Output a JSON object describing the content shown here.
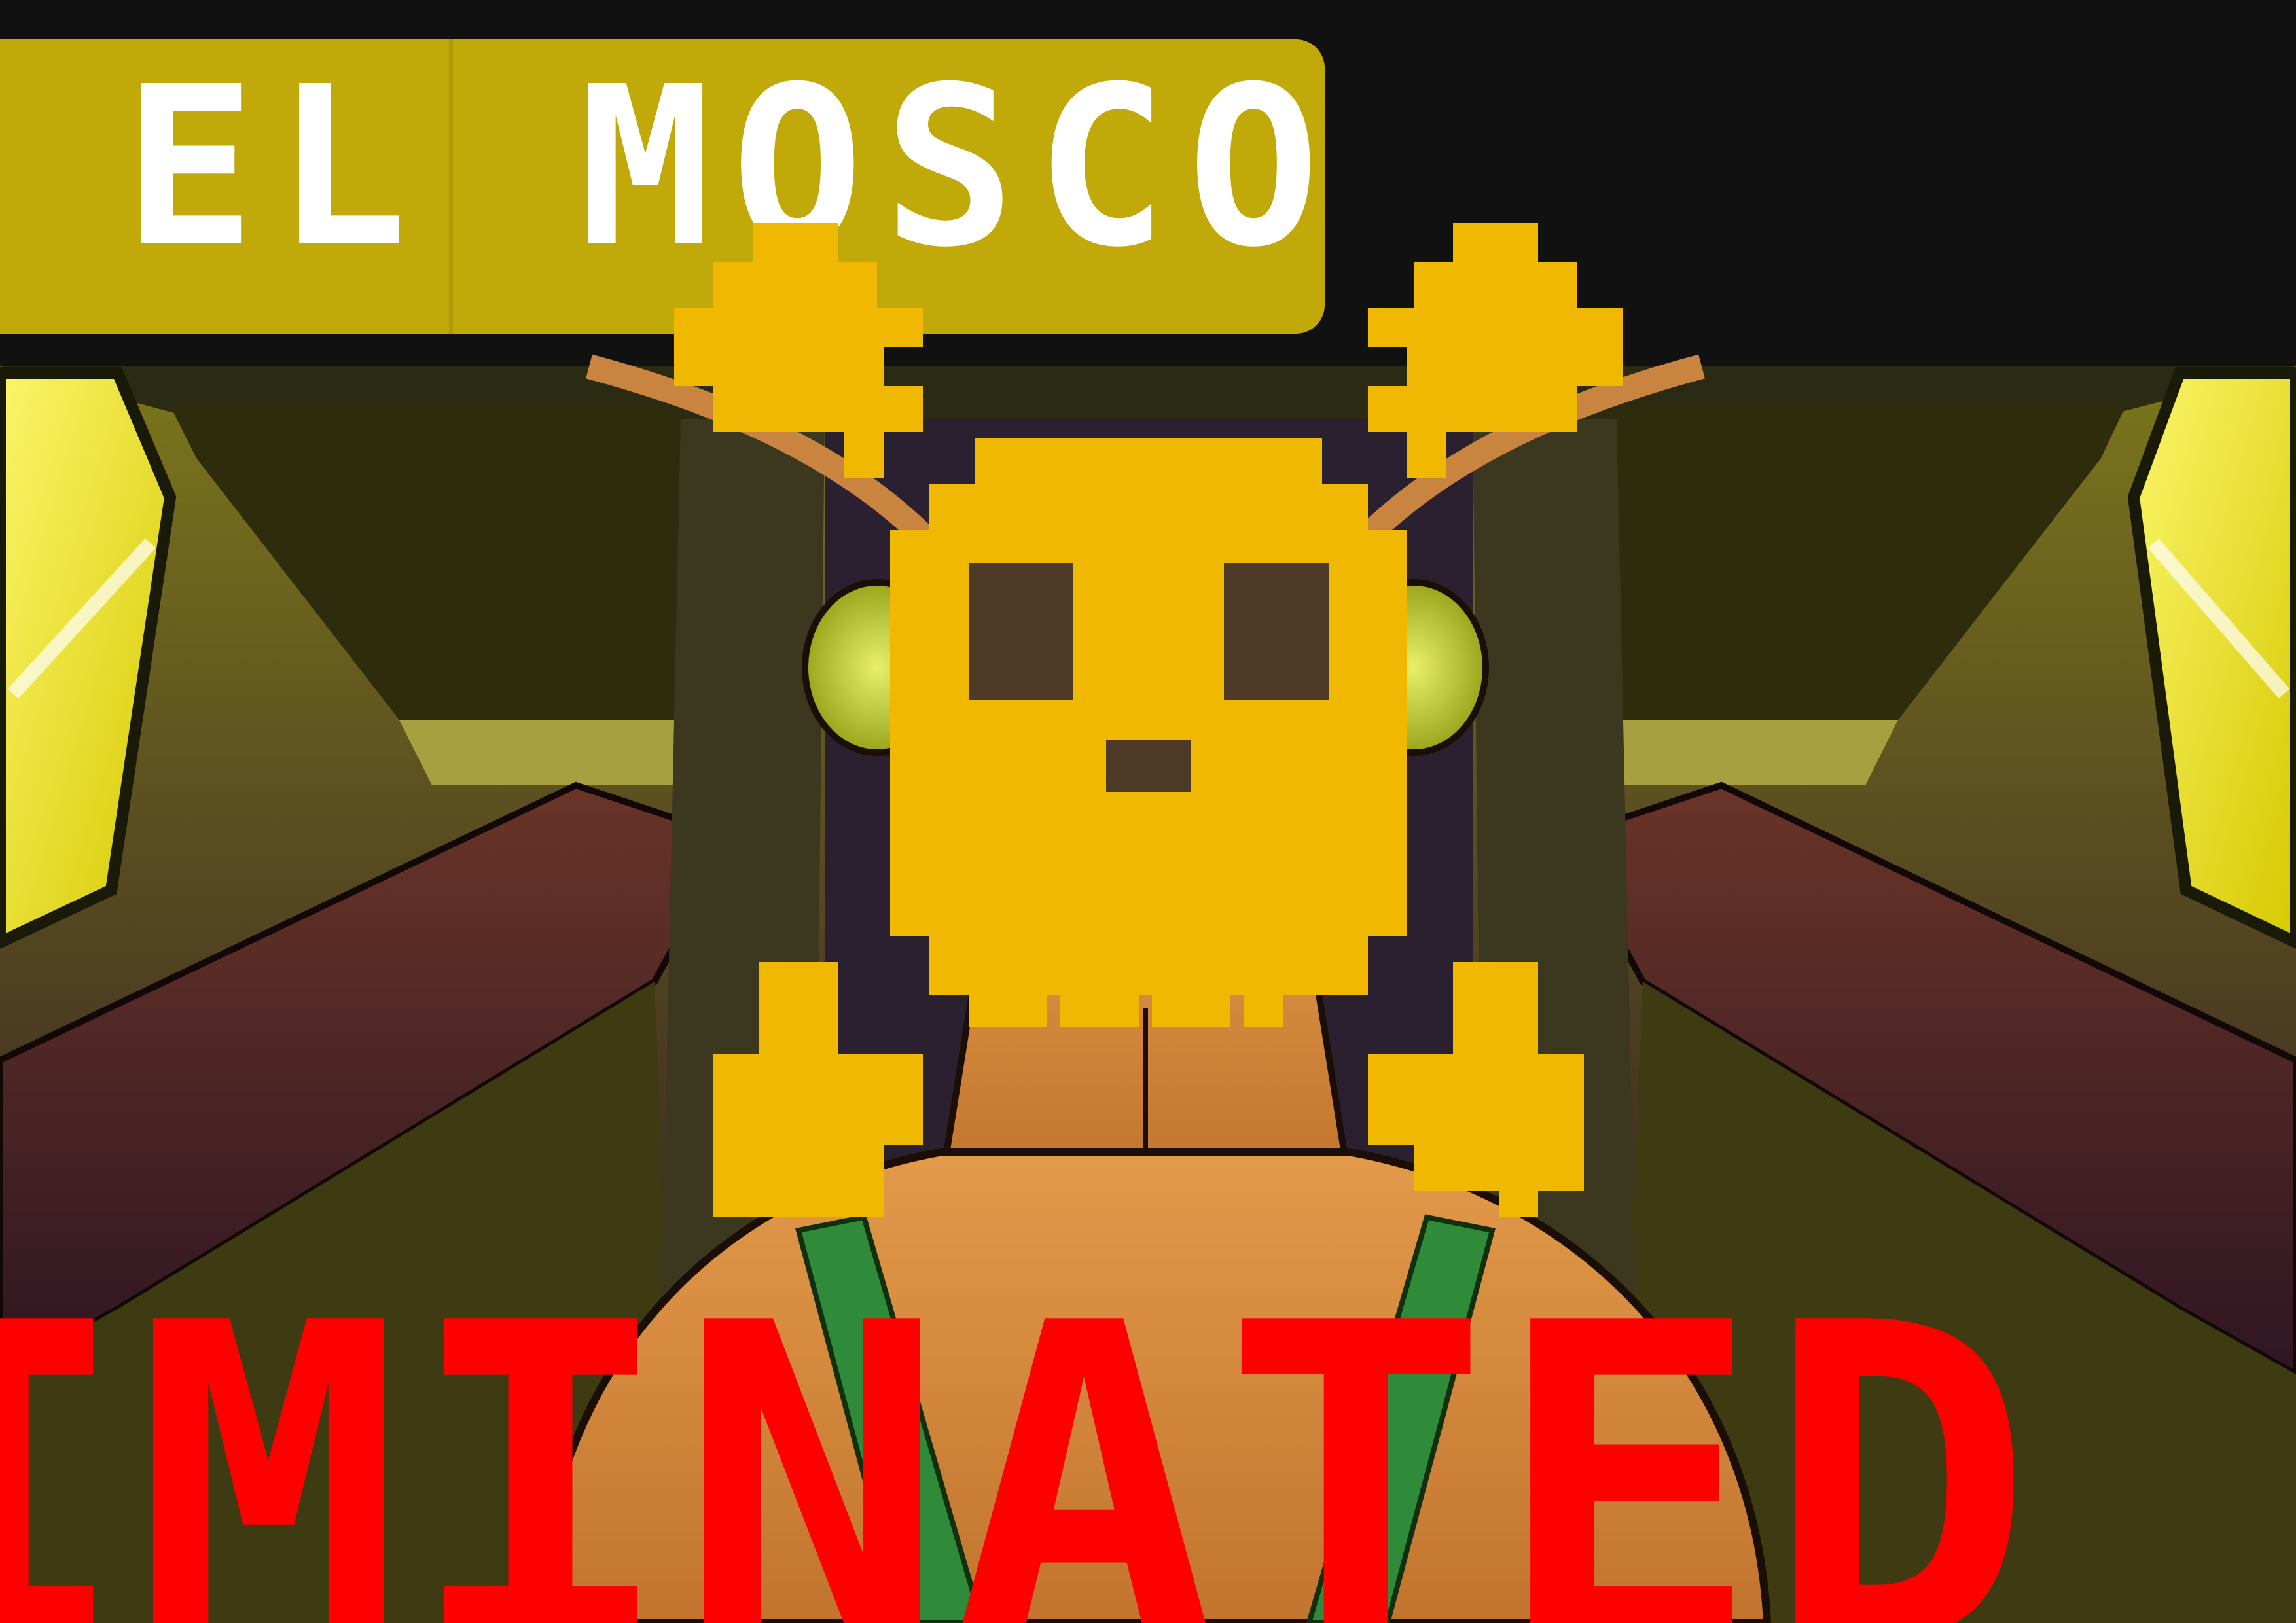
{
  "character": {
    "name": "EL MOSCO"
  },
  "status": {
    "text": "IMINATED",
    "icon": "pixel-skull-crossbones-icon"
  },
  "colors": {
    "banner": "#c2a90a",
    "name_text": "#ffffff",
    "skull": "#f0b800",
    "status_text": "#ff0000",
    "window_glow": "#f4f000",
    "skin": "#d98a3e",
    "strap": "#2f8a3a",
    "seat": "#5a2a24",
    "cabin_wall": "#6f6a1c"
  }
}
